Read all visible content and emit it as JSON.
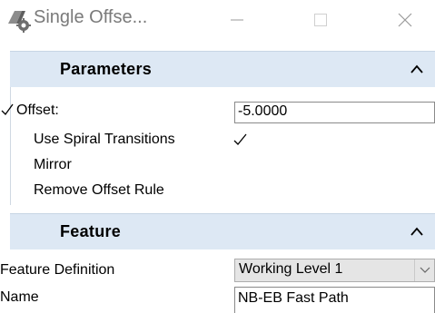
{
  "window": {
    "title": "Single Offse...",
    "icon": "offset-tool-icon",
    "controls": [
      "minimize",
      "maximize",
      "close"
    ]
  },
  "parameters": {
    "header": "Parameters",
    "offset_label": "Offset:",
    "offset_value": "-5.0000",
    "offset_checked": true,
    "use_spiral_label": "Use Spiral Transitions",
    "use_spiral_checked": true,
    "mirror_label": "Mirror",
    "remove_offset_rule_label": "Remove Offset Rule"
  },
  "feature": {
    "header": "Feature",
    "definition_label": "Feature Definition",
    "definition_value": "Working Level 1",
    "name_label": "Name",
    "name_value": "NB-EB Fast Path"
  },
  "colors": {
    "section_header_bg": "#dde8f4",
    "title_text": "#7a7a7a",
    "select_bg": "#e5e5e5"
  }
}
